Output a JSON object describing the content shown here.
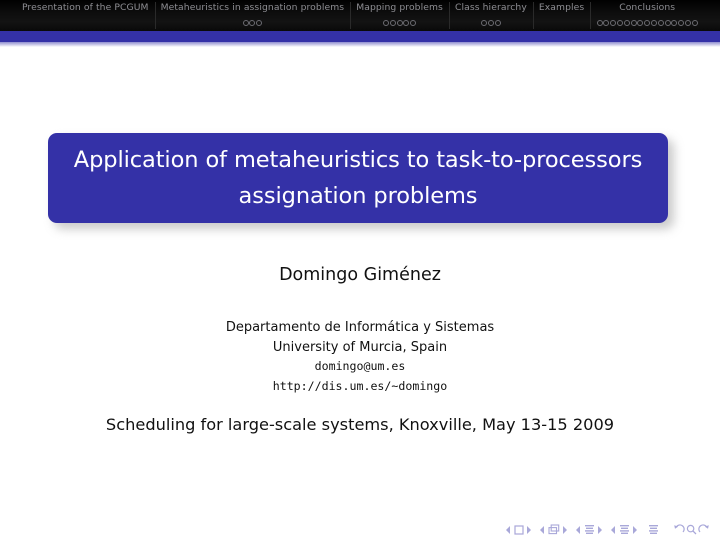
{
  "header": {
    "sections": [
      {
        "title": "Presentation of the PCGUM",
        "frames": 0
      },
      {
        "title": "Metaheuristics in assignation problems",
        "frames": 3
      },
      {
        "title": "Mapping problems",
        "frames": 5
      },
      {
        "title": "Class hierarchy",
        "frames": 3
      },
      {
        "title": "Examples",
        "frames": 0
      },
      {
        "title": "Conclusions",
        "frames": 15
      }
    ]
  },
  "title": {
    "line1": "Application of metaheuristics to task-to-processors",
    "line2": "assignation problems"
  },
  "author": {
    "name": "Domingo Giménez"
  },
  "institute": {
    "department": "Departamento de Informática y Sistemas",
    "university": "University of Murcia, Spain",
    "email": "domingo@um.es",
    "url": "http://dis.um.es/~domingo"
  },
  "conference": {
    "text": "Scheduling for large-scale systems, Knoxville, May 13-15 2009"
  },
  "navsymbols": {
    "first_slide": "first-slide-icon",
    "prev_slide": "prev-slide-icon",
    "slide_icon": "slide-icon",
    "next_slide": "next-slide-icon",
    "last_slide": "last-slide-icon",
    "frame_icon": "frame-icon",
    "subsection_icon": "subsection-icon",
    "section_icon": "section-icon",
    "doc_icon": "document-icon",
    "back_icon": "go-back-icon",
    "search_icon": "search-icon",
    "forward_icon": "go-forward-icon"
  },
  "colors": {
    "beamer_blue": "#3431a7",
    "header_bg": "#0a0a0a",
    "header_text": "#8e8e93",
    "title_text": "#ffffff",
    "body_text": "#111111"
  }
}
